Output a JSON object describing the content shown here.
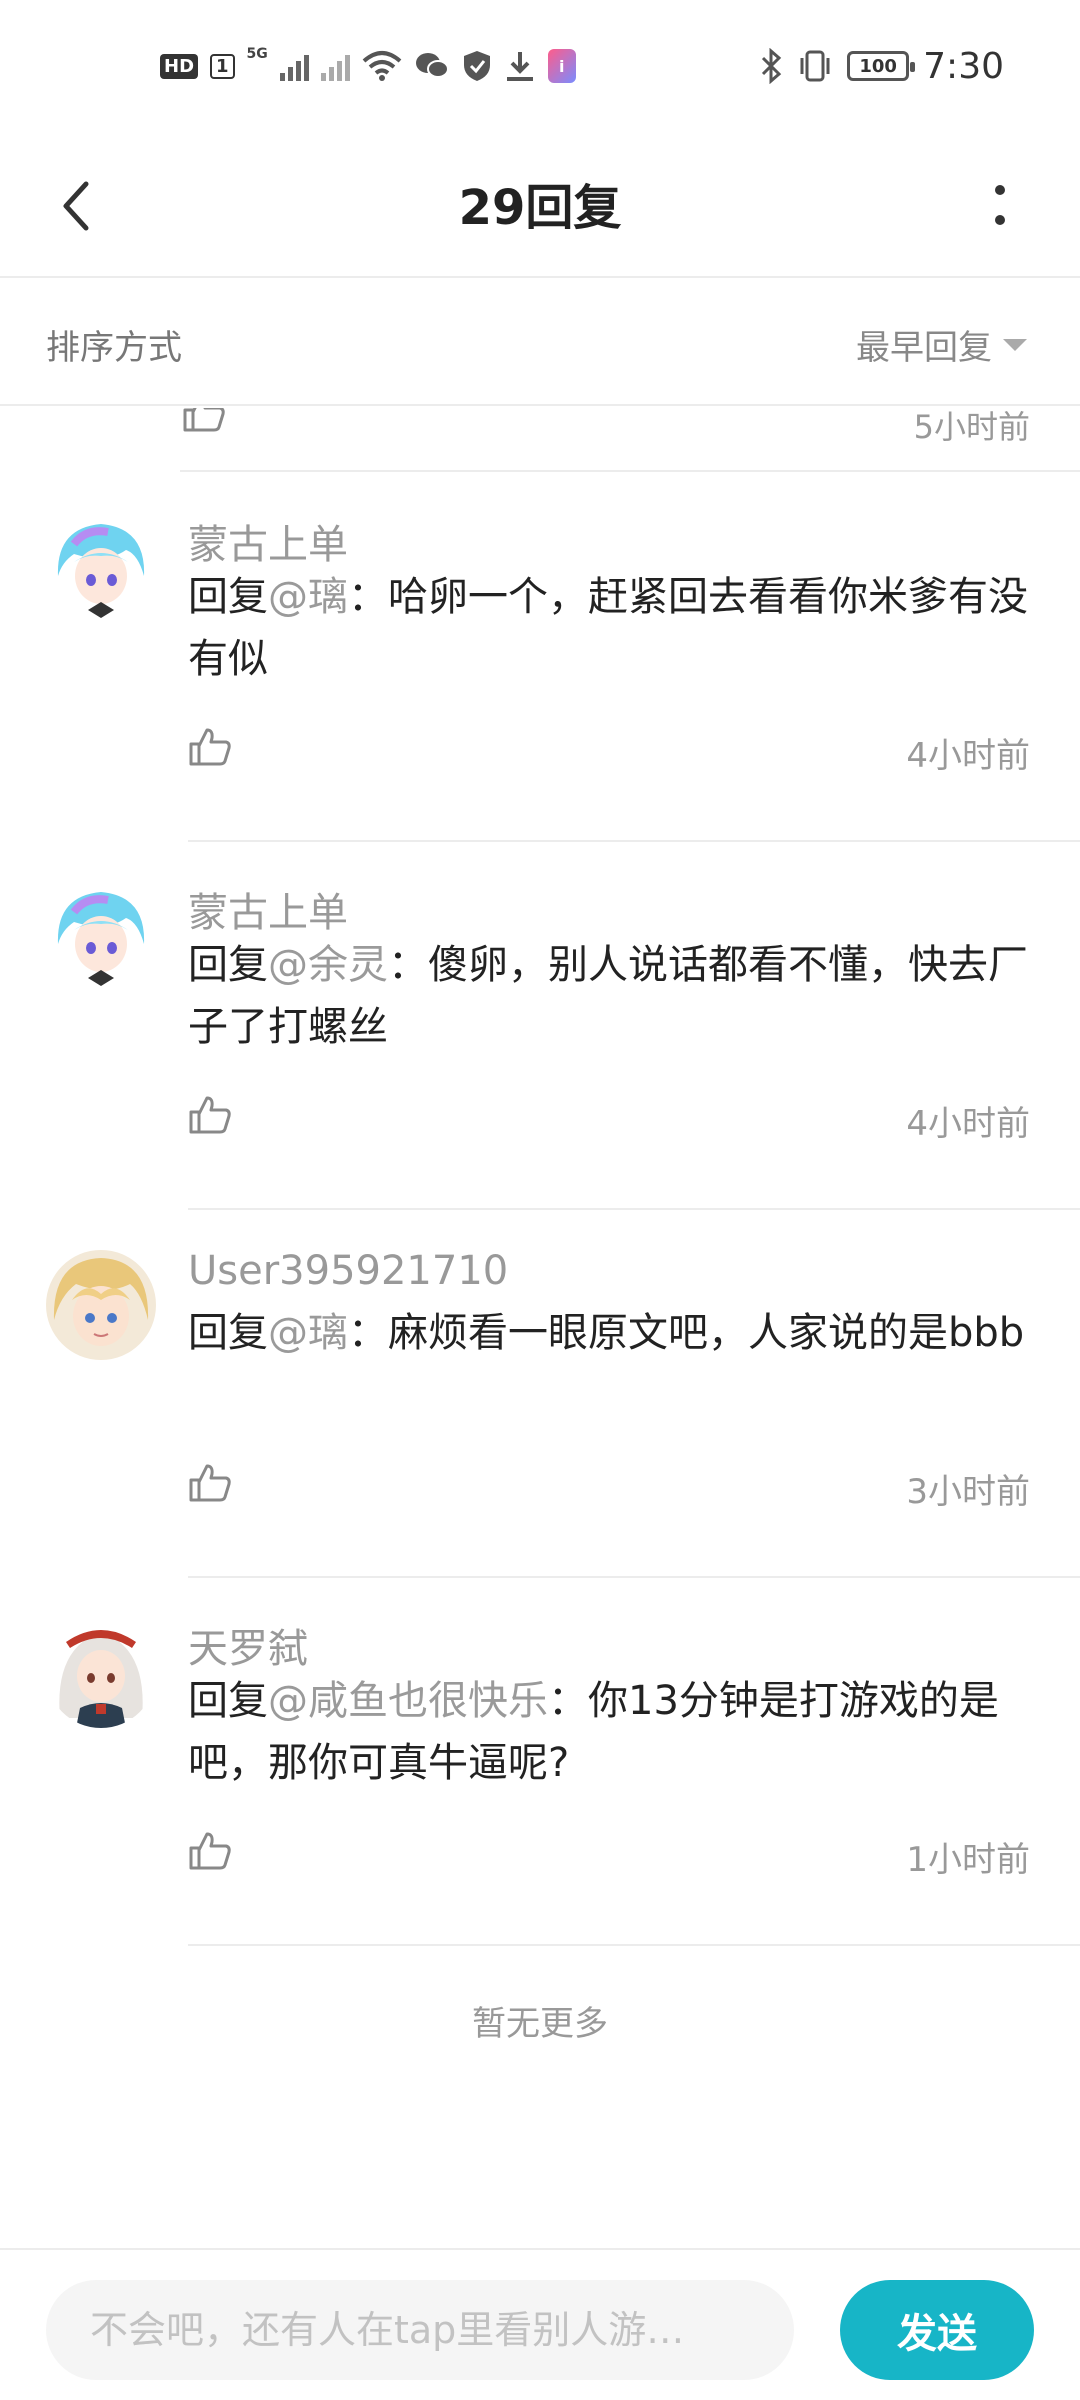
{
  "status_bar": {
    "hd_label": "HD",
    "sim_label": "1",
    "network_label": "5G",
    "battery": "100",
    "time": "7:30",
    "icons": [
      "signal-icon",
      "wifi-icon",
      "wechat-icon",
      "shield-icon",
      "download-icon",
      "app-badge-icon",
      "bluetooth-icon",
      "vibrate-icon",
      "battery-icon"
    ]
  },
  "header": {
    "title": "29回复"
  },
  "sort": {
    "label": "排序方式",
    "selected": "最早回复"
  },
  "partial_item": {
    "time": "5小时前"
  },
  "replies": [
    {
      "username": "蒙古上单",
      "prefix": "回复",
      "mention": "@璃",
      "text": "：哈卵一个，赶紧回去看看你米爹有没有似",
      "time": "4小时前",
      "avatar": "anime-girl-blue-hair"
    },
    {
      "username": "蒙古上单",
      "prefix": "回复",
      "mention": "@余灵",
      "text": "：傻卵，别人说话都看不懂，快去厂子了打螺丝",
      "time": "4小时前",
      "avatar": "anime-girl-blue-hair"
    },
    {
      "username": "User395921710",
      "prefix": "回复",
      "mention": "@璃",
      "text": "：麻烦看一眼原文吧，人家说的是bbb",
      "time": "3小时前",
      "avatar": "anime-boy-blonde"
    },
    {
      "username": "天罗弑",
      "prefix": "回复",
      "mention": "@咸鱼也很快乐",
      "text": "：你13分钟是打游戏的是吧，那你可真牛逼呢?",
      "time": "1小时前",
      "avatar": "anime-girl-silver-hair"
    }
  ],
  "footer_note": "暂无更多",
  "compose": {
    "placeholder": "不会吧，还有人在tap里看别人游…",
    "send_label": "发送"
  },
  "colors": {
    "accent": "#17b5c7",
    "muted": "#999999"
  }
}
